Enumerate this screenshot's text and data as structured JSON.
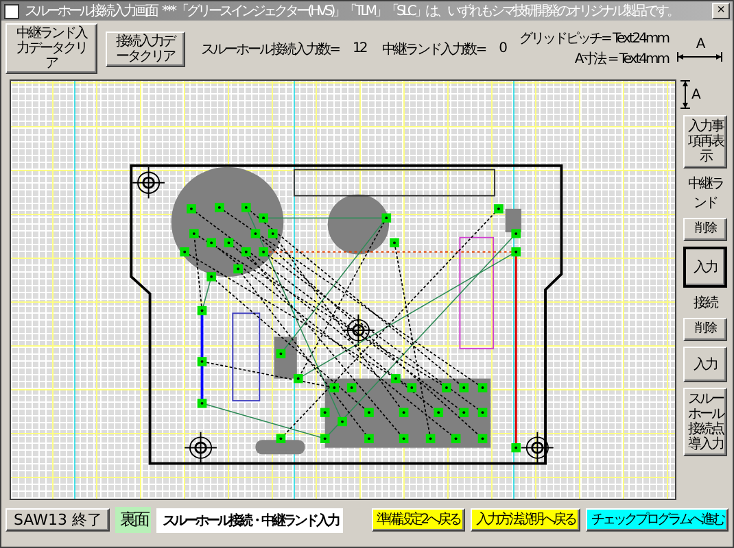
{
  "window": {
    "title": "スルーホール接続入力画面",
    "notice": "*** 「グリースインジェクター(HVS)」「TLM」「SLC」は、いずれもシマ技研開発のオリジナル製品です。",
    "close": "×"
  },
  "toolbar": {
    "buttons": [
      "中継ランド入力データクリア",
      "接続入力データクリア"
    ],
    "counters": [
      {
        "label": "スルーホール接続入力数=",
        "value": "12"
      },
      {
        "label": "中継ランド入力数=",
        "value": "0"
      }
    ],
    "grid_pitch": "グリッドピッチ= Text24mm",
    "a_size": "A寸法 = Text4mm",
    "dimension_label": "A"
  },
  "side_panel": {
    "dimension_label": "A",
    "items": [
      {
        "kind": "button",
        "label": "入力事項再表示",
        "focused": false
      },
      {
        "kind": "label",
        "label": "中継ランド"
      },
      {
        "kind": "small",
        "label": "削除",
        "focused": false
      },
      {
        "kind": "button",
        "label": "入力",
        "focused": true
      },
      {
        "kind": "label",
        "label": "接続"
      },
      {
        "kind": "small",
        "label": "削除",
        "focused": false
      },
      {
        "kind": "button",
        "label": "入力",
        "focused": false
      },
      {
        "kind": "button",
        "label": "スルーホール接続点導入力",
        "focused": false
      }
    ]
  },
  "bottom_bar": {
    "exit_button": "SAW13 終了",
    "side_label": "裏面",
    "mode_field": "スルーホール接続・中継ランド入力",
    "nav_buttons": [
      {
        "label": "準備設定2へ戻る",
        "color": "#ffff00"
      },
      {
        "label": "入力方法説明へ戻る",
        "color": "#ffff00"
      },
      {
        "label": "チェックプログラムへ進む",
        "color": "#00ffff"
      }
    ]
  }
}
